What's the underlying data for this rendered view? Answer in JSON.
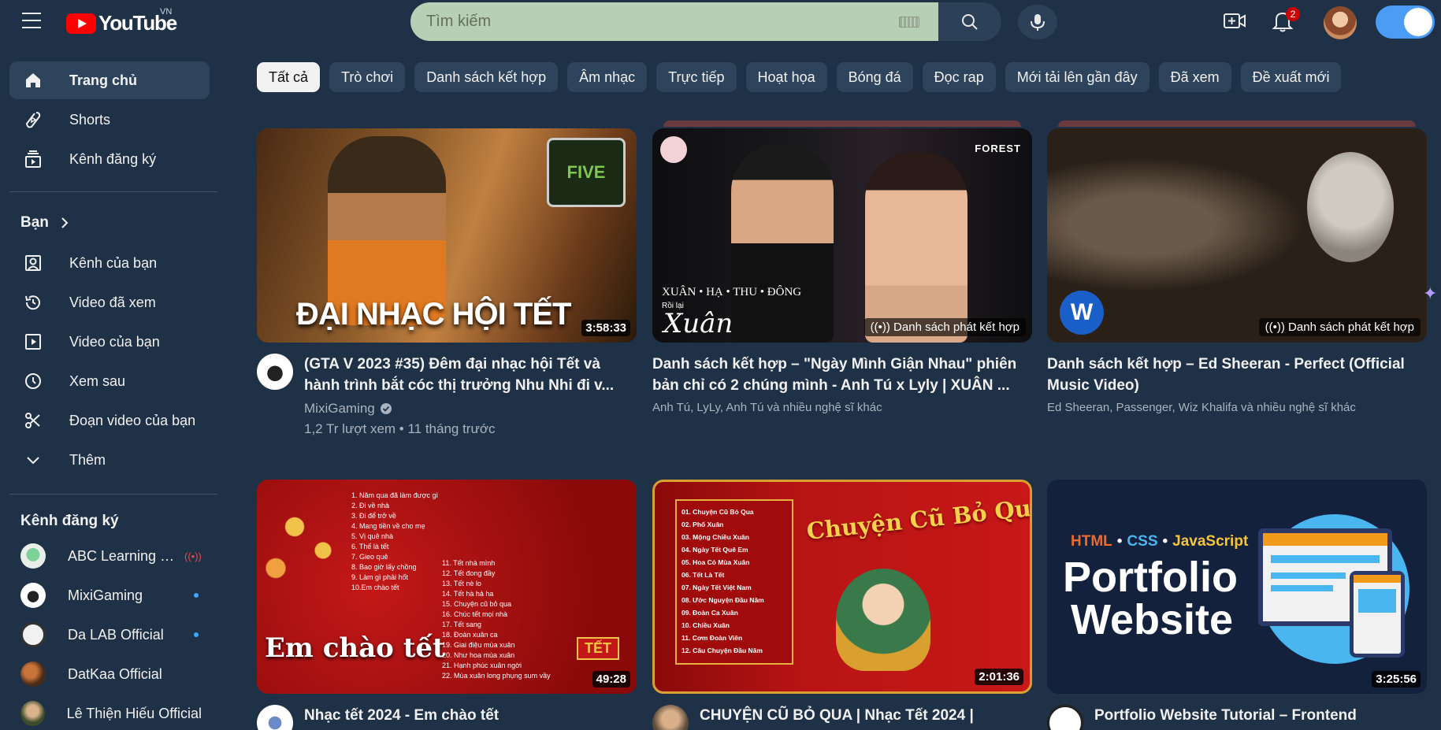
{
  "header": {
    "logo_text": "YouTube",
    "region": "VN",
    "search_placeholder": "Tìm kiếm",
    "notification_count": "2"
  },
  "sidebar": {
    "main": [
      {
        "label": "Trang chủ",
        "icon": "home-icon"
      },
      {
        "label": "Shorts",
        "icon": "shorts-icon"
      },
      {
        "label": "Kênh đăng ký",
        "icon": "subscriptions-icon"
      }
    ],
    "you_title": "Bạn",
    "you": [
      {
        "label": "Kênh của bạn",
        "icon": "channel-icon"
      },
      {
        "label": "Video đã xem",
        "icon": "history-icon"
      },
      {
        "label": "Video của bạn",
        "icon": "your-videos-icon"
      },
      {
        "label": "Xem sau",
        "icon": "watch-later-icon"
      },
      {
        "label": "Đoạn video của bạn",
        "icon": "clips-icon"
      },
      {
        "label": "Thêm",
        "icon": "chevron-down-icon"
      }
    ],
    "subs_title": "Kênh đăng ký",
    "subs": [
      {
        "name": "ABC Learning En...",
        "indicator": "live"
      },
      {
        "name": "MixiGaming",
        "indicator": "dot"
      },
      {
        "name": "Da LAB Official",
        "indicator": "dot"
      },
      {
        "name": "DatKaa Official",
        "indicator": ""
      },
      {
        "name": "Lê Thiện Hiếu Official",
        "indicator": ""
      }
    ]
  },
  "chips": [
    "Tất cả",
    "Trò chơi",
    "Danh sách kết hợp",
    "Âm nhạc",
    "Trực tiếp",
    "Hoạt họa",
    "Bóng đá",
    "Đọc rap",
    "Mới tải lên gần đây",
    "Đã xem",
    "Đề xuất mới"
  ],
  "videos": [
    {
      "title": "(GTA V 2023 #35) Đêm đại nhạc hội Tết và hành trình bắt cóc thị trưởng Nhu Nhi đi v...",
      "channel": "MixiGaming",
      "stats": "1,2 Tr lượt xem • 11 tháng trước",
      "duration": "3:58:33",
      "thumb_text": "ĐẠI NHẠC HỘI TẾT",
      "thumb_logo": "FIVE"
    },
    {
      "title": "Danh sách kết hợp – \"Ngày Mình Giận Nhau\" phiên bản chỉ có 2 chúng mình - Anh Tú x Lyly | XUÂN ...",
      "artists": "Anh Tú, LyLy, Anh Tú và nhiều nghệ sĩ khác",
      "badge": "Danh sách phát kết hợp",
      "thumb_caption": "XUÂN • HẠ • THU • ĐÔNG",
      "thumb_sub": "Rồi lại",
      "thumb_sign": "Xuân",
      "thumb_brand": "FOREST"
    },
    {
      "title": "Danh sách kết hợp – Ed Sheeran - Perfect (Official Music Video)",
      "artists": "Ed Sheeran, Passenger, Wiz Khalifa và nhiều nghệ sĩ khác",
      "badge": "Danh sách phát kết hợp"
    },
    {
      "title": "Nhạc tết 2024 - Em chào tết",
      "duration": "49:28",
      "thumb_text": "Em chào tết",
      "thumb_tag": "TẾT",
      "tracklist_a": [
        "1. Năm qua đã làm được gì",
        "2. Đi về nhà",
        "3. Đi để trở về",
        "4. Mang tiền về cho mẹ",
        "5. Vị quê nhà",
        "6. Thế là tết",
        "7. Gieo quẻ",
        "8. Bao giờ lấy chồng",
        "9. Làm gì phải hốt",
        "10.Em chào tết"
      ],
      "tracklist_b": [
        "11. Tết nhà mình",
        "12. Tết đong đầy",
        "13. Tết nè lo",
        "14. Tết hà hả ha",
        "15. Chuyện cũ bỏ qua",
        "16. Chúc tết mọi nhà",
        "17. Tết sang",
        "18. Đoàn xuân ca",
        "19. Giai điệu mùa xuân",
        "20. Như hoa mùa xuân",
        "21. Hạnh phúc xuân ngời",
        "22. Mùa xuân long phụng sum vầy"
      ]
    },
    {
      "title": "CHUYỆN CŨ BỎ QUA | Nhạc Tết 2024 |",
      "duration": "2:01:36",
      "thumb_text": "Chuyện Cũ Bỏ Qua",
      "tracklist": [
        "01. Chuyện Cũ Bỏ Qua",
        "02. Phố Xuân",
        "03. Mộng Chiều Xuân",
        "04. Ngày Tết Quê Em",
        "05. Hoa Cỏ Mùa Xuân",
        "06. Tết Là Tết",
        "07. Ngày Tết Việt Nam",
        "08. Ước Nguyện Đầu Năm",
        "09. Đoàn Ca Xuân",
        "10. Chiều Xuân",
        "11. Cơm Đoàn Viên",
        "12. Câu Chuyện Đầu Năm"
      ]
    },
    {
      "title": "Portfolio Website Tutorial – Frontend",
      "duration": "3:25:56",
      "thumb_line1": "Portfolio",
      "thumb_line2": "Website",
      "thumb_tags": [
        "HTML",
        "CSS",
        "JavaScript"
      ]
    }
  ]
}
